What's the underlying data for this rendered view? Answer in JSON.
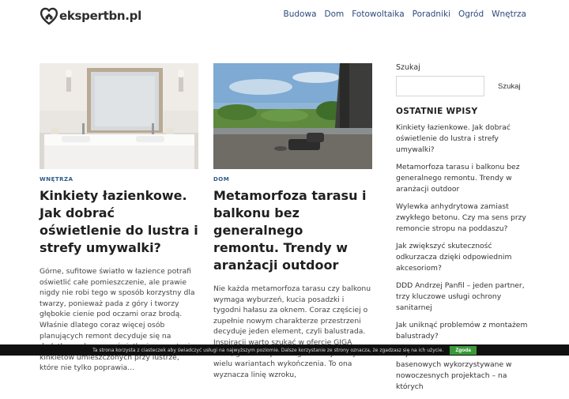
{
  "header": {
    "logo_text": "ekspertbn.pl",
    "nav": [
      "Budowa",
      "Dom",
      "Fotowoltaika",
      "Poradniki",
      "Ogród",
      "Wnętrza"
    ]
  },
  "posts": [
    {
      "category": "WNĘTRZA",
      "title": "Kinkiety łazienkowe. Jak dobrać oświetlenie do lustra i strefy umywalki?",
      "excerpt": "Górne, sufitowe światło w łazience potrafi oświetlić całe pomieszczenie, ale prawie nigdy nie robi tego w sposób korzystny dla twarzy, ponieważ pada z góry i tworzy głębokie cienie pod oczami oraz brodą. Właśnie dlatego coraz więcej osób planujących remont decyduje się na dodatkowe, boczne oświetlenie w postaci kinkietów umieszczonych przy lustrze, które nie tylko poprawia…",
      "image": "bathroom-mirror-photo"
    },
    {
      "category": "DOM",
      "title": "Metamorfoza tarasu i balkonu bez generalnego remontu. Trendy w aranżacji outdoor",
      "excerpt": "Nie każda metamorfoza tarasu czy balkonu wymaga wyburzeń, kucia posadzki i tygodni hałasu za oknem. Coraz częściej o zupełnie nowym charakterze przestrzeni decyduje jeden element, czyli balustrada. Inspiracji warto szukać w ofercie GIGA STAL, gdzie znajdziesz gotowe systemy w wielu wariantach wykończenia. To ona wyznacza linię wzroku,",
      "image": "terrace-photo"
    }
  ],
  "sidebar": {
    "search_label": "Szukaj",
    "search_button": "Szukaj",
    "search_value": "",
    "recent_heading": "OSTATNIE WPISY",
    "recent": [
      "Kinkiety łazienkowe. Jak dobrać oświetlenie do lustra i strefy umywalki?",
      "Metamorfoza tarasu i balkonu bez generalnego remontu. Trendy w aranżacji outdoor",
      "Wylewka anhydrytowa zamiast zwykłego betonu. Czy ma sens przy remoncie stropu na poddaszu?",
      "Jak zwiększyć skuteczność odkurzacza dzięki odpowiednim akcesoriom?",
      "DDD Andrzej Panfil – jeden partner, trzy kluczowe usługi ochrony sanitarnej",
      "Jak uniknąć problemów z montażem balustrady?",
      "Najciekawsze marki mozaik basenowych wykorzystywane w nowoczesnych projektach – na których"
    ]
  },
  "cookie": {
    "text": "Ta strona korzysta z ciasteczek aby świadczyć usługi na najwyższym poziomie. Dalsze korzystanie ze strony oznacza, że zgadzasz się na ich użycie.",
    "button": "Zgoda"
  },
  "colors": {
    "nav": "#2c4a7a",
    "category": "#2c5a8a",
    "cookie_bg": "#111111",
    "cookie_btn": "#3a9a3a"
  }
}
